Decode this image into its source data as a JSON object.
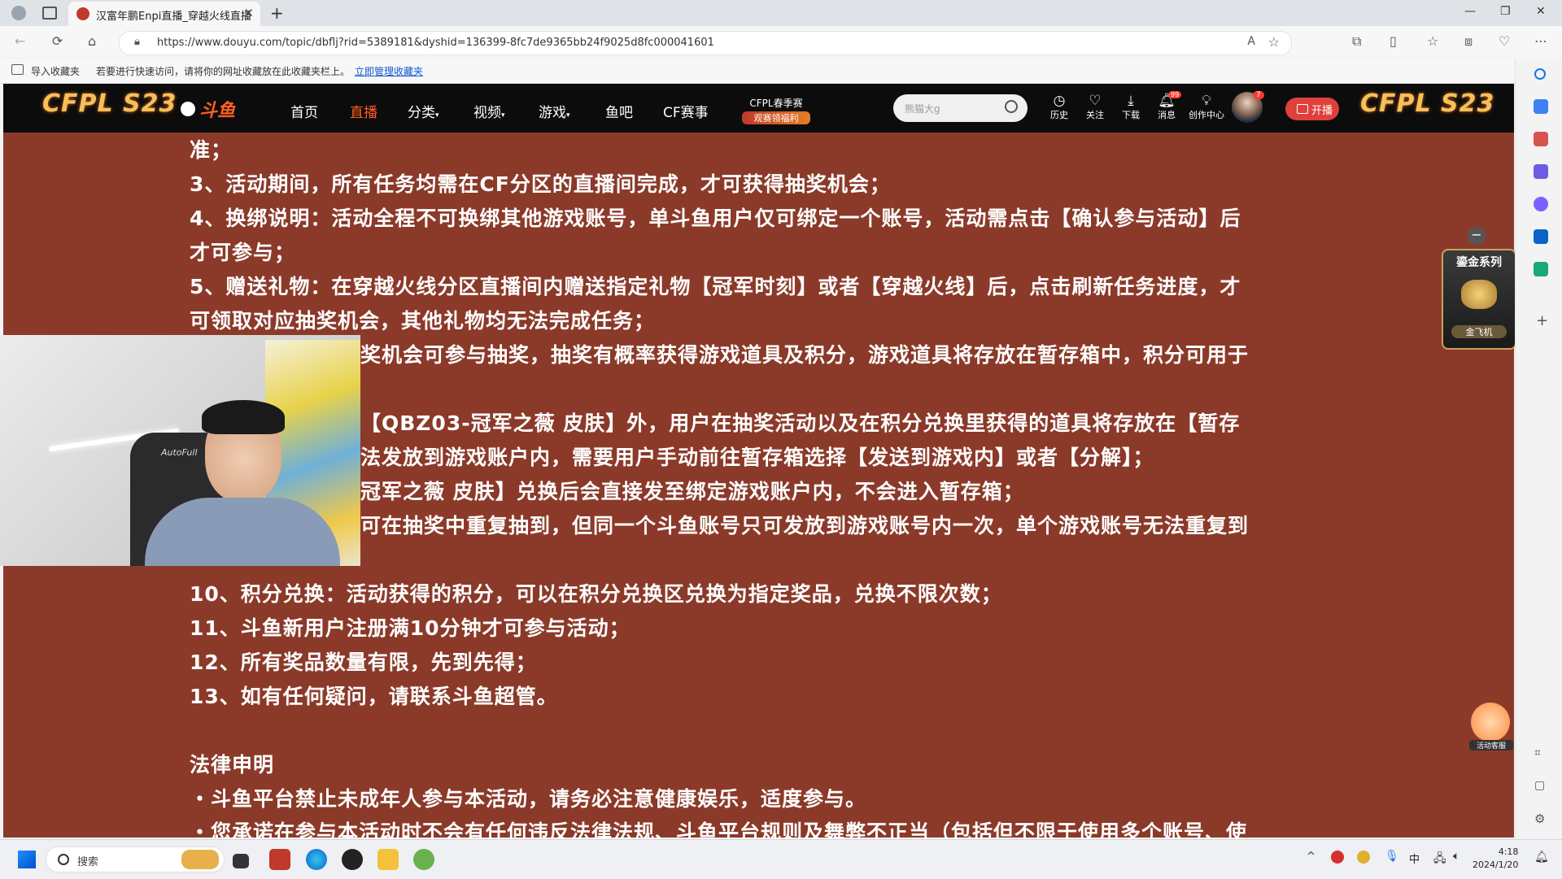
{
  "browser": {
    "tab_title": "汉富年鹏Enpi直播_穿越火线直播",
    "url": "https://www.douyu.com/topic/dbflj?rid=5389181&dyshid=136399-8fc7de9365bb24f9025d8fc000041601",
    "favorites_bar": {
      "import_label": "导入收藏夹",
      "hint": "若要进行快速访问，请将你的网址收藏放在此收藏夹栏上。",
      "manage_link": "立即管理收藏夹"
    }
  },
  "site": {
    "logo_left": "CFPL S23",
    "brand": "斗鱼",
    "nav": [
      "首页",
      "直播",
      "分类",
      "视频",
      "游戏",
      "鱼吧",
      "CF赛事"
    ],
    "active_nav": "直播",
    "promo_line1": "CFPL春季赛",
    "promo_line2": "观赛领福利",
    "search_placeholder": "熊猫大g",
    "icons": {
      "history": "历史",
      "follow": "关注",
      "download": "下载",
      "messages": "消息",
      "creator": "创作中心"
    },
    "message_badge": "99",
    "avatar_badge": "7",
    "open_button": "开播",
    "logo_right": "CFPL S23"
  },
  "article": {
    "lines": [
      "准；",
      "3、活动期间，所有任务均需在CF分区的直播间完成，才可获得抽奖机会；",
      "4、换绑说明：活动全程不可换绑其他游戏账号，单斗鱼用户仅可绑定一个账号，活动需点击【确认参与活动】后",
      "才可参与；",
      "5、赠送礼物：在穿越火线分区直播间内赠送指定礼物【冠军时刻】或者【穿越火线】后，点击刷新任务进度，才",
      "可领取对应抽奖机会，其他礼物均无法完成任务；",
      "奖机会可参与抽奖，抽奖有概率获得游戏道具及积分，游戏道具将存放在暂存箱中，积分可用于",
      "",
      "【QBZ03-冠军之薇 皮肤】外，用户在抽奖活动以及在积分兑换里获得的道具将存放在【暂存",
      "法发放到游戏账户内，需要用户手动前往暂存箱选择【发送到游戏内】或者【分解】；",
      "冠军之薇 皮肤】兑换后会直接发至绑定游戏账户内，不会进入暂存箱；",
      "可在抽奖中重复抽到，但同一个斗鱼账号只可发放到游戏账号内一次，单个游戏账号无法重复到",
      "",
      "10、积分兑换：活动获得的积分，可以在积分兑换区兑换为指定奖品，兑换不限次数；",
      "11、斗鱼新用户注册满10分钟才可参与活动；",
      "12、所有奖品数量有限，先到先得；",
      "13、如有任何疑问，请联系斗鱼超管。",
      "",
      "法律申明",
      "・斗鱼平台禁止未成年人参与本活动，请务必注意健康娱乐，适度参与。",
      "・您承诺在参与本活动时不会有任何违反法律法规、斗鱼平台规则及舞弊不正当（包括但不限于使用多个账号、使"
    ]
  },
  "floating": {
    "promo_title": "鎏金系列",
    "promo_item": "金飞机",
    "service_label": "活动客服"
  },
  "webcam": {
    "chair_brand": "AutoFull"
  },
  "taskbar": {
    "search_label": "搜索",
    "ime": "中",
    "time": "4:18",
    "date": "2024/1/20"
  }
}
